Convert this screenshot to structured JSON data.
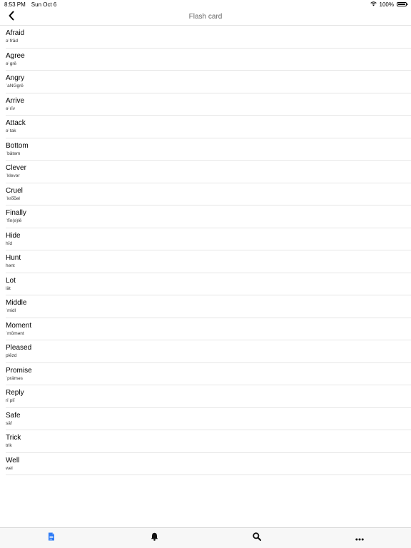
{
  "status_bar": {
    "time": "8:53 PM",
    "date": "Sun Oct 6",
    "battery": "100%",
    "battery_level": 1.0
  },
  "nav": {
    "title": "Flash card",
    "back_icon": "chevron-left-icon"
  },
  "words": [
    {
      "word": "Afraid",
      "phonetic": "əˈfrād"
    },
    {
      "word": "Agree",
      "phonetic": "əˈgrē"
    },
    {
      "word": "Angry",
      "phonetic": "ˈaNGgrē"
    },
    {
      "word": "Arrive",
      "phonetic": "əˈrīv"
    },
    {
      "word": "Attack",
      "phonetic": "əˈtak"
    },
    {
      "word": "Bottom",
      "phonetic": "ˈbätəm"
    },
    {
      "word": "Clever",
      "phonetic": "ˈklevər"
    },
    {
      "word": "Cruel",
      "phonetic": "ˈkro͞oəl"
    },
    {
      "word": "Finally",
      "phonetic": "ˈfīn(ə)lē"
    },
    {
      "word": "Hide",
      "phonetic": "hīd"
    },
    {
      "word": "Hunt",
      "phonetic": "hənt"
    },
    {
      "word": "Lot",
      "phonetic": "lät"
    },
    {
      "word": "Middle",
      "phonetic": "ˈmidl"
    },
    {
      "word": "Moment",
      "phonetic": "ˈmōmənt"
    },
    {
      "word": "Pleased",
      "phonetic": "plēzd"
    },
    {
      "word": "Promise",
      "phonetic": "ˈpräməs"
    },
    {
      "word": "Reply",
      "phonetic": "riˈplī"
    },
    {
      "word": "Safe",
      "phonetic": "sāf"
    },
    {
      "word": "Trick",
      "phonetic": "trik"
    },
    {
      "word": "Well",
      "phonetic": "wel"
    }
  ],
  "tabs": [
    {
      "name": "document-icon",
      "active": true
    },
    {
      "name": "bell-icon",
      "active": false
    },
    {
      "name": "search-icon",
      "active": false
    },
    {
      "name": "more-icon",
      "active": false
    }
  ],
  "colors": {
    "accent": "#2f7cf6",
    "tab_icon": "#111111"
  }
}
